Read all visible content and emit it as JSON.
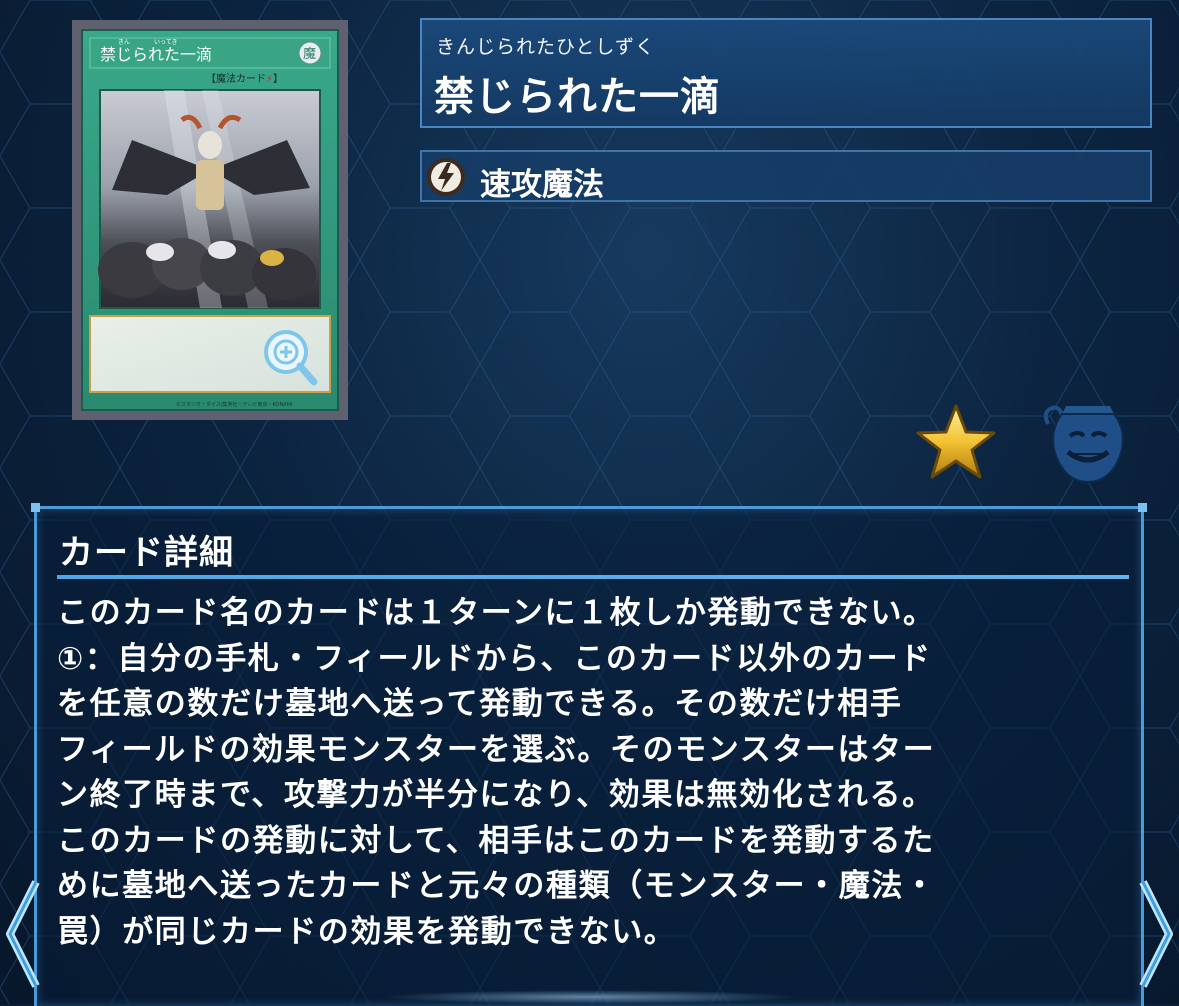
{
  "card": {
    "ruby": "きんじられたひとしずく",
    "name": "禁じられた一滴",
    "type_icon": "quick-play-spell-icon",
    "type_label": "速攻魔法",
    "art": {
      "card_title": "禁じられた一滴",
      "title_ruby": "きん　　　　いってき",
      "attribute_glyph": "魔",
      "type_line": "【魔法カード",
      "type_line_icon": "⚡",
      "type_line_end": "】",
      "footer": "©スタジオ・ダイス/集英社・テレビ東京・KONAMI"
    }
  },
  "actions": {
    "favorite_icon": "star-icon",
    "pot_icon": "pot-of-greed-icon",
    "zoom_icon": "zoom-in-icon",
    "prev_icon": "chevron-left-icon",
    "next_icon": "chevron-right-icon"
  },
  "details": {
    "title": "カード詳細",
    "lines": [
      "このカード名のカードは１ターンに１枚しか発動できない。",
      "①：自分の手札・フィールドから、このカード以外のカード",
      "を任意の数だけ墓地へ送って発動できる。その数だけ相手",
      "フィールドの効果モンスターを選ぶ。そのモンスターはター",
      "ン終了時まで、攻撃力が半分になり、効果は無効化される。",
      "このカードの発動に対して、相手はこのカードを発動するた",
      "めに墓地へ送ったカードと元々の種類（モンスター・魔法・",
      "罠）が同じカードの効果を発動できない。"
    ]
  },
  "colors": {
    "background": "#0c2440",
    "panel_border": "#4e9ad8",
    "card_frame": "#2f9a7c",
    "star": "#f3c53b",
    "pot": "#1f4f86"
  }
}
